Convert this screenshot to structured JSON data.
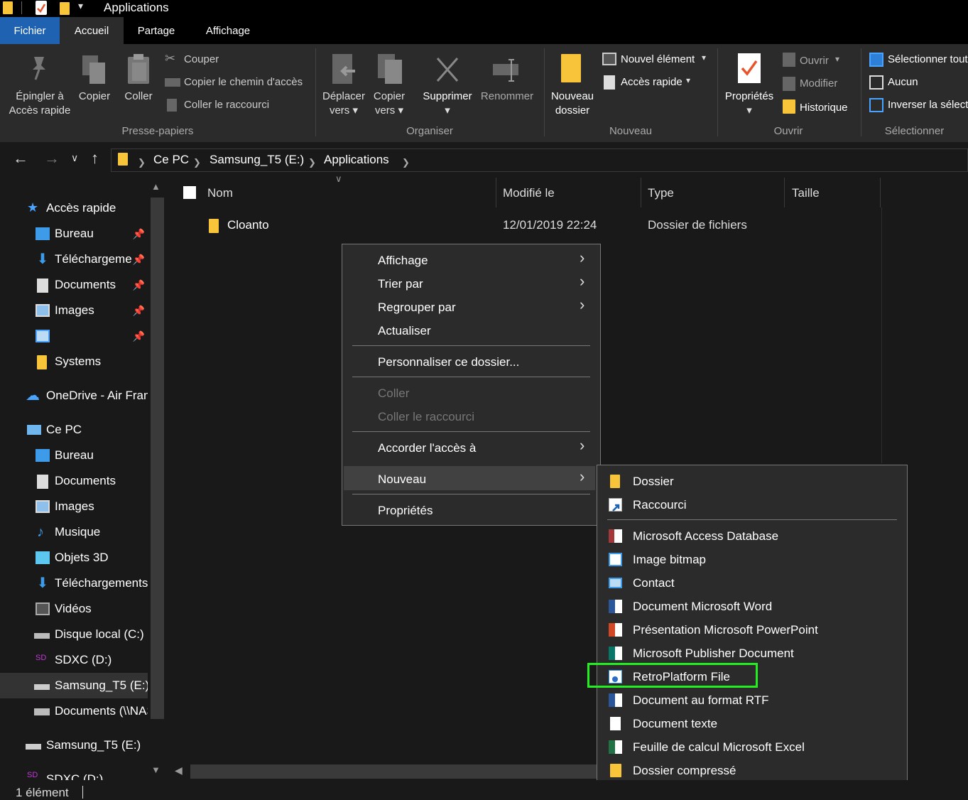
{
  "window": {
    "title": "Applications"
  },
  "tabs": {
    "file": "Fichier",
    "home": "Accueil",
    "share": "Partage",
    "view": "Affichage"
  },
  "ribbon": {
    "clipboard": {
      "pin": "Épingler à\nAccès rapide",
      "copy": "Copier",
      "paste": "Coller",
      "cut": "Couper",
      "copy_path": "Copier le chemin d'accès",
      "paste_shortcut": "Coller le raccourci",
      "group": "Presse-papiers"
    },
    "organize": {
      "move_to_1": "Déplacer",
      "move_to_2": "vers",
      "copy_to_1": "Copier",
      "copy_to_2": "vers",
      "delete": "Supprimer",
      "rename": "Renommer",
      "group": "Organiser"
    },
    "new": {
      "new_folder_1": "Nouveau",
      "new_folder_2": "dossier",
      "new_item": "Nouvel élément",
      "easy_access": "Accès rapide",
      "group": "Nouveau"
    },
    "open": {
      "properties": "Propriétés",
      "open": "Ouvrir",
      "edit": "Modifier",
      "history": "Historique",
      "group": "Ouvrir"
    },
    "select": {
      "select_all": "Sélectionner tout",
      "select_none": "Aucun",
      "invert": "Inverser la sélection",
      "group": "Sélectionner"
    }
  },
  "address": {
    "crumbs": [
      "Ce PC",
      "Samsung_T5 (E:)",
      "Applications"
    ]
  },
  "sidebar": {
    "quick_access": "Accès rapide",
    "items": [
      "Bureau",
      "Téléchargements",
      "Documents",
      "Images",
      "",
      "Systems",
      "OneDrive - Air France",
      "Ce PC",
      "Bureau",
      "Documents",
      "Images",
      "Musique",
      "Objets 3D",
      "Téléchargements",
      "Vidéos",
      "Disque local (C:)",
      "SDXC (D:)",
      "Samsung_T5 (E:)",
      "Documents (\\\\NAS)",
      "Samsung_T5 (E:)",
      "SDXC (D:)"
    ]
  },
  "columns": {
    "name": "Nom",
    "modified": "Modifié le",
    "type": "Type",
    "size": "Taille"
  },
  "files": [
    {
      "name": "Cloanto",
      "modified": "12/01/2019 22:24",
      "type": "Dossier de fichiers"
    }
  ],
  "context_menu": {
    "view": "Affichage",
    "sort": "Trier par",
    "group": "Regrouper par",
    "refresh": "Actualiser",
    "customize": "Personnaliser ce dossier...",
    "paste": "Coller",
    "paste_shortcut": "Coller le raccourci",
    "give_access": "Accorder l'accès à",
    "new": "Nouveau",
    "properties": "Propriétés"
  },
  "submenu": {
    "folder": "Dossier",
    "shortcut": "Raccourci",
    "items": [
      "Microsoft Access Database",
      "Image bitmap",
      "Contact",
      "Document Microsoft Word",
      "Présentation Microsoft PowerPoint",
      "Microsoft Publisher Document",
      "RetroPlatform File",
      "Document au format RTF",
      "Document texte",
      "Feuille de calcul Microsoft Excel",
      "Dossier compressé"
    ]
  },
  "status": {
    "count": "1 élément"
  },
  "colors": {
    "highlight": "#22ee22",
    "file_tab": "#1f62b1",
    "folder": "#f8c43a"
  }
}
